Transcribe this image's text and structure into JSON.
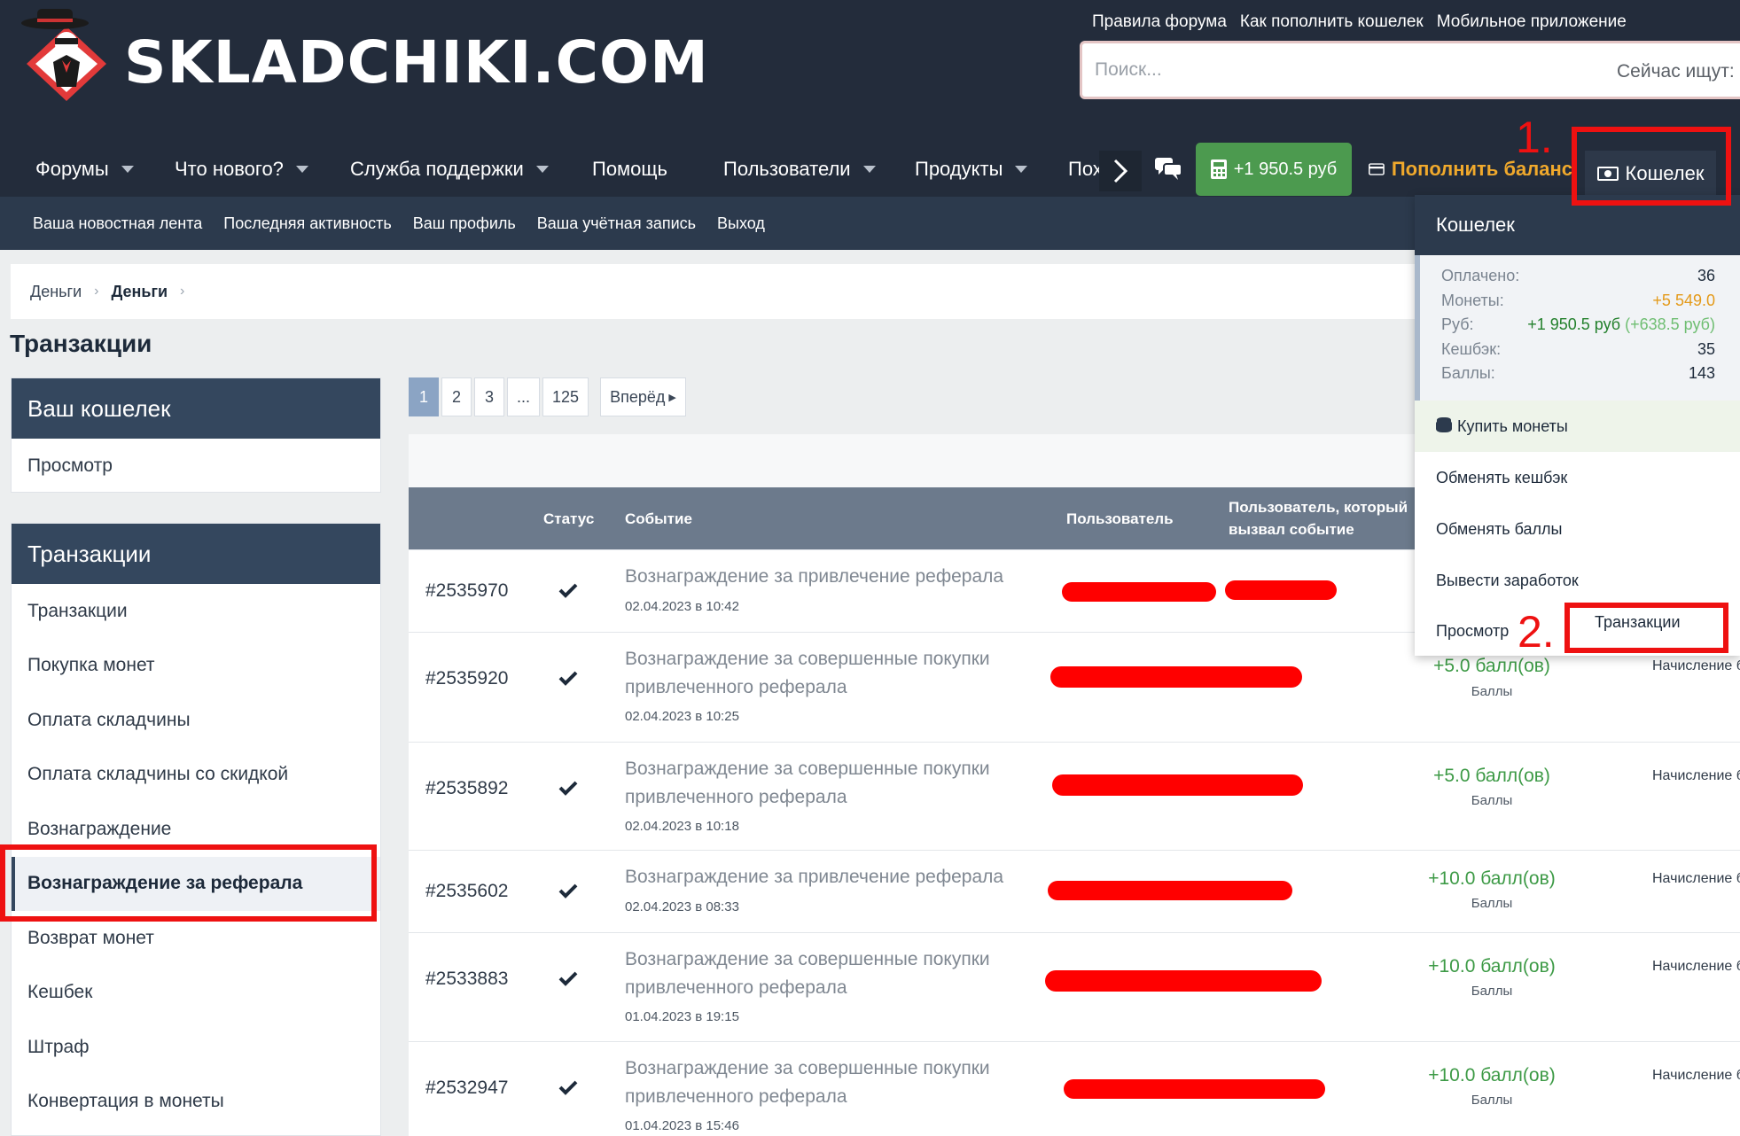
{
  "header": {
    "logo_text": "SKLADCHIKI.COM",
    "top_links": [
      "Правила форума",
      "Как пополнить кошелек",
      "Мобильное приложение"
    ],
    "search_placeholder": "Поиск...",
    "search_now_label": "Сейчас ищут:"
  },
  "nav": {
    "items": [
      "Форумы",
      "Что нового?",
      "Служба поддержки",
      "Помощь",
      "Пользователи",
      "Продукты",
      "Пох"
    ],
    "balance": "+1 950.5 руб",
    "topup": "Пополнить баланс",
    "wallet": "Кошелек"
  },
  "subnav": [
    "Ваша новостная лента",
    "Последняя активность",
    "Ваш профиль",
    "Ваша учётная запись",
    "Выход"
  ],
  "breadcrumb": [
    "Деньги",
    "Деньги"
  ],
  "page_title": "Транзакции",
  "sidebar": {
    "wallet_title": "Ваш кошелек",
    "wallet_items": [
      "Просмотр"
    ],
    "tx_title": "Транзакции",
    "tx_items": [
      "Транзакции",
      "Покупка монет",
      "Оплата складчины",
      "Оплата складчины со скидкой",
      "Вознаграждение",
      "Вознаграждение за реферала",
      "Возврат монет",
      "Кешбек",
      "Штраф",
      "Конвертация в монеты"
    ],
    "active_item": "Вознаграждение за реферала"
  },
  "pagination": {
    "pages": [
      "1",
      "2",
      "3",
      "...",
      "125"
    ],
    "current": "1",
    "next": "Вперёд"
  },
  "table": {
    "headers": {
      "status": "Статус",
      "event": "Событие",
      "user": "Пользователь",
      "caused_by": "Пользователь, который вызвал событие"
    },
    "rows": [
      {
        "id": "#2535970",
        "event": "Вознаграждение за привлечение реферала",
        "date": "02.04.2023 в 10:42",
        "amount": "",
        "unit": "",
        "desc": ""
      },
      {
        "id": "#2535920",
        "event": "Вознаграждение за совершенные покупки привлеченного реферала",
        "date": "02.04.2023 в 10:25",
        "amount": "+5.0 балл(ов)",
        "unit": "Баллы",
        "desc": "Начисление б привлеченно"
      },
      {
        "id": "#2535892",
        "event": "Вознаграждение за совершенные покупки привлеченного реферала",
        "date": "02.04.2023 в 10:18",
        "amount": "+5.0 балл(ов)",
        "unit": "Баллы",
        "desc": "Начисление б привлеченно"
      },
      {
        "id": "#2535602",
        "event": "Вознаграждение за привлечение реферала",
        "date": "02.04.2023 в 08:33",
        "amount": "+10.0 балл(ов)",
        "unit": "Баллы",
        "desc": "Начисление б borik"
      },
      {
        "id": "#2533883",
        "event": "Вознаграждение за совершенные покупки привлеченного реферала",
        "date": "01.04.2023 в 19:15",
        "amount": "+10.0 балл(ов)",
        "unit": "Баллы",
        "desc": "Начисление б привлеченно"
      },
      {
        "id": "#2532947",
        "event": "Вознаграждение за совершенные покупки привлеченного реферала",
        "date": "01.04.2023 в 15:46",
        "amount": "+10.0 балл(ов)",
        "unit": "Баллы",
        "desc": "Начисление б привлеченно"
      }
    ]
  },
  "wallet_menu": {
    "title": "Кошелек",
    "stats": [
      {
        "label": "Оплачено:",
        "value": "36"
      },
      {
        "label": "Монеты:",
        "value": "+5 549.0"
      },
      {
        "label": "Руб:",
        "value": "+1 950.5 руб",
        "delta": "(+638.5 руб)"
      },
      {
        "label": "Кешбэк:",
        "value": "35"
      },
      {
        "label": "Баллы:",
        "value": "143"
      }
    ],
    "items": [
      "Купить монеты",
      "Обменять кешбэк",
      "Обменять баллы",
      "Вывести заработок"
    ],
    "view": "Просмотр",
    "transactions": "Транзакции"
  },
  "annotations": {
    "step1": "1.",
    "step2": "2."
  },
  "colors": {
    "header_bg": "#232c3b",
    "accent_green": "#4c9a4f",
    "topup_orange": "#f0a92c",
    "annotation_red": "#ee1111",
    "table_head": "#6c7a8c"
  },
  "icons": [
    "spy-logo-icon",
    "chevron-right-icon",
    "chat-icon",
    "calculator-icon",
    "credit-card-icon",
    "wallet-icon",
    "coins-icon",
    "check-icon",
    "caret-down-icon"
  ]
}
